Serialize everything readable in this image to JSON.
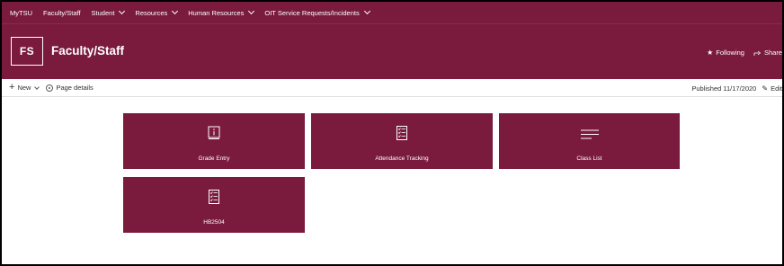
{
  "topnav": {
    "items": [
      {
        "label": "MyTSU",
        "has_dropdown": false
      },
      {
        "label": "Faculty/Staff",
        "has_dropdown": false
      },
      {
        "label": "Student",
        "has_dropdown": true
      },
      {
        "label": "Resources",
        "has_dropdown": true
      },
      {
        "label": "Human Resources",
        "has_dropdown": true
      },
      {
        "label": "OIT Service Requests/Incidents",
        "has_dropdown": true
      }
    ]
  },
  "site": {
    "logo_text": "FS",
    "title": "Faculty/Staff",
    "following_label": "Following",
    "share_label": "Share"
  },
  "commandbar": {
    "new_label": "New",
    "page_details_label": "Page details",
    "published_text": "Published 11/17/2020",
    "edit_label": "Edit"
  },
  "tiles": [
    {
      "label": "Grade Entry",
      "icon": "book-info-icon"
    },
    {
      "label": "Attendance Tracking",
      "icon": "checklist-icon"
    },
    {
      "label": "Class List",
      "icon": "text-lines-icon"
    },
    {
      "label": "HB2504",
      "icon": "checklist-icon"
    }
  ],
  "colors": {
    "brand": "#7a1a3d",
    "white": "#ffffff",
    "text": "#323130"
  }
}
